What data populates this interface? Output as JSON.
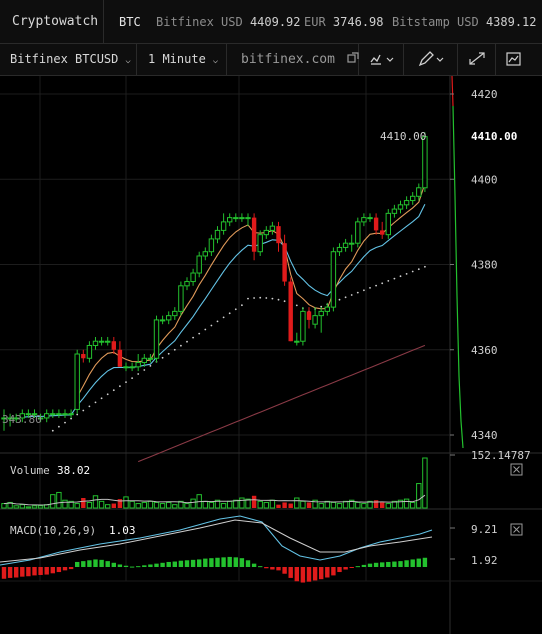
{
  "app": {
    "brand": "Cryptowatch"
  },
  "ticker": {
    "asset": "BTC",
    "items": [
      {
        "label": "Bitfinex USD",
        "value": "4409.92"
      },
      {
        "label": "EUR",
        "value": "3746.98"
      },
      {
        "label": "Bitstamp USD",
        "value": "4389.12"
      }
    ]
  },
  "toolbar": {
    "market": "Bitfinex BTCUSD",
    "interval": "1 Minute",
    "exchange_link": "bitfinex.com",
    "icons": [
      "external-link-icon",
      "chart-type-icon",
      "chevron-down-icon",
      "pencil-icon",
      "chevron-down-icon",
      "fullscreen-icon",
      "settings-icon"
    ]
  },
  "colors": {
    "up": "#23c12e",
    "down": "#e01b1b",
    "ema_fast": "#e09a5a",
    "ema_slow": "#63c3e6",
    "sma": "#8a3a46",
    "bg": "#000000",
    "grid": "#222222"
  },
  "price_axis": {
    "ticks": [
      4420,
      4400,
      4380,
      4360,
      4340
    ],
    "last_price": "4410.00",
    "left_marker": "343.80"
  },
  "volume_panel": {
    "label": "Volume",
    "value": "38.02",
    "axis_value": "152.14787"
  },
  "macd_panel": {
    "label": "MACD(10,26,9)",
    "value": "1.03",
    "axis_high": "9.21",
    "axis_low": "1.92"
  },
  "chart_data": {
    "type": "candlestick",
    "timeframe": "1 Minute",
    "ylim": [
      4335,
      4428
    ],
    "candles": [
      [
        4344,
        4346,
        4341,
        4344
      ],
      [
        4344,
        4345,
        4342,
        4344
      ],
      [
        4344,
        4345,
        4343,
        4344
      ],
      [
        4344,
        4346,
        4343,
        4345
      ],
      [
        4345,
        4346,
        4344,
        4345
      ],
      [
        4345,
        4346,
        4344,
        4345
      ],
      [
        4344,
        4345,
        4343,
        4344
      ],
      [
        4344,
        4346,
        4343,
        4345
      ],
      [
        4345,
        4346,
        4344,
        4345
      ],
      [
        4345,
        4346,
        4344,
        4345
      ],
      [
        4345,
        4346,
        4344,
        4345
      ],
      [
        4345,
        4346,
        4344,
        4345
      ],
      [
        4346,
        4360,
        4345,
        4359
      ],
      [
        4359,
        4360,
        4357,
        4358
      ],
      [
        4358,
        4362,
        4357,
        4361
      ],
      [
        4361,
        4363,
        4360,
        4362
      ],
      [
        4362,
        4363,
        4361,
        4362
      ],
      [
        4362,
        4363,
        4361,
        4362
      ],
      [
        4362,
        4363,
        4359,
        4360
      ],
      [
        4360,
        4362,
        4356,
        4356
      ],
      [
        4356,
        4357,
        4355,
        4356
      ],
      [
        4356,
        4357,
        4355,
        4356
      ],
      [
        4356,
        4359,
        4355,
        4357
      ],
      [
        4357,
        4359,
        4356,
        4358
      ],
      [
        4358,
        4359,
        4357,
        4358
      ],
      [
        4358,
        4368,
        4357,
        4367
      ],
      [
        4367,
        4368,
        4366,
        4367
      ],
      [
        4367,
        4369,
        4366,
        4368
      ],
      [
        4368,
        4370,
        4367,
        4369
      ],
      [
        4369,
        4376,
        4368,
        4375
      ],
      [
        4375,
        4377,
        4374,
        4376
      ],
      [
        4376,
        4379,
        4375,
        4378
      ],
      [
        4378,
        4383,
        4377,
        4382
      ],
      [
        4382,
        4384,
        4381,
        4383
      ],
      [
        4383,
        4387,
        4382,
        4386
      ],
      [
        4386,
        4389,
        4385,
        4388
      ],
      [
        4388,
        4392,
        4387,
        4390
      ],
      [
        4390,
        4392,
        4389,
        4391
      ],
      [
        4391,
        4392,
        4390,
        4391
      ],
      [
        4391,
        4392,
        4390,
        4391
      ],
      [
        4391,
        4392,
        4389,
        4391
      ],
      [
        4391,
        4392,
        4381,
        4383
      ],
      [
        4383,
        4388,
        4382,
        4387
      ],
      [
        4387,
        4389,
        4386,
        4388
      ],
      [
        4388,
        4390,
        4387,
        4389
      ],
      [
        4389,
        4390,
        4383,
        4385
      ],
      [
        4385,
        4387,
        4375,
        4376
      ],
      [
        4376,
        4377,
        4362,
        4362
      ],
      [
        4362,
        4364,
        4361,
        4362
      ],
      [
        4362,
        4370,
        4361,
        4369
      ],
      [
        4369,
        4370,
        4365,
        4367
      ],
      [
        4366,
        4370,
        4365,
        4368
      ],
      [
        4368,
        4370,
        4364,
        4369
      ],
      [
        4369,
        4371,
        4368,
        4370
      ],
      [
        4370,
        4384,
        4369,
        4383
      ],
      [
        4383,
        4385,
        4382,
        4384
      ],
      [
        4384,
        4386,
        4383,
        4385
      ],
      [
        4385,
        4387,
        4383,
        4385
      ],
      [
        4385,
        4391,
        4384,
        4390
      ],
      [
        4390,
        4392,
        4389,
        4391
      ],
      [
        4391,
        4392,
        4390,
        4391
      ],
      [
        4391,
        4392,
        4387,
        4388
      ],
      [
        4388,
        4390,
        4386,
        4387
      ],
      [
        4387,
        4393,
        4386,
        4392
      ],
      [
        4392,
        4394,
        4391,
        4393
      ],
      [
        4393,
        4395,
        4392,
        4394
      ],
      [
        4394,
        4396,
        4393,
        4395
      ],
      [
        4395,
        4397,
        4394,
        4396
      ],
      [
        4396,
        4399,
        4395,
        4398
      ],
      [
        4398,
        4411,
        4397,
        4410
      ]
    ],
    "volume": [
      4,
      5,
      2,
      3,
      1,
      2,
      2,
      3,
      12,
      14,
      7,
      6,
      4,
      9,
      5,
      11,
      6,
      3,
      4,
      8,
      10,
      6,
      4,
      5,
      6,
      5,
      4,
      5,
      3,
      6,
      4,
      8,
      12,
      6,
      5,
      7,
      4,
      6,
      7,
      9,
      8,
      11,
      6,
      5,
      7,
      3,
      5,
      4,
      9,
      6,
      5,
      7,
      4,
      6,
      5,
      4,
      6,
      7,
      5,
      4,
      6,
      7,
      5,
      4,
      6,
      7,
      8,
      5,
      22,
      45
    ],
    "macd": [
      -2.8,
      -2.6,
      -2.5,
      -2.3,
      -2.2,
      -2.0,
      -1.9,
      -1.8,
      -1.5,
      -1.2,
      -0.8,
      -0.5,
      1.2,
      1.4,
      1.6,
      1.8,
      1.7,
      1.4,
      1.0,
      0.6,
      0.3,
      0.1,
      0.2,
      0.4,
      0.6,
      0.8,
      1.0,
      1.2,
      1.3,
      1.5,
      1.6,
      1.7,
      1.8,
      2.0,
      2.1,
      2.2,
      2.3,
      2.4,
      2.3,
      2.1,
      1.6,
      0.8,
      0.2,
      -0.3,
      -0.6,
      -0.8,
      -1.6,
      -2.6,
      -3.4,
      -3.7,
      -3.5,
      -3.2,
      -2.9,
      -2.5,
      -2.0,
      -1.2,
      -0.6,
      -0.2,
      0.2,
      0.5,
      0.8,
      1.0,
      1.1,
      1.2,
      1.3,
      1.4,
      1.6,
      1.8,
      2.0,
      2.2
    ]
  }
}
